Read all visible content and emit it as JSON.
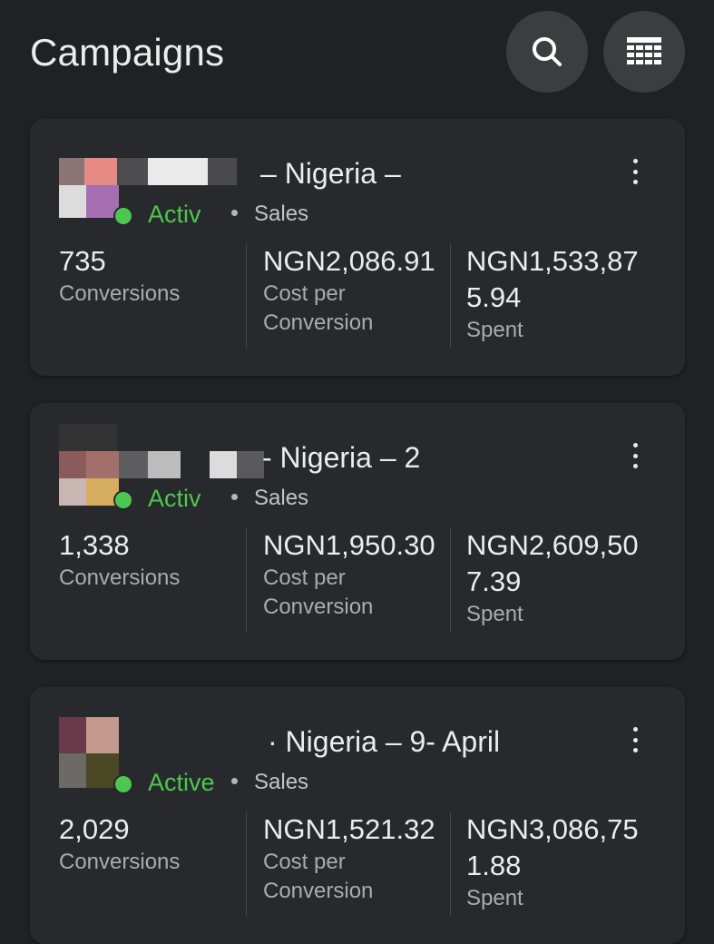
{
  "header": {
    "title": "Campaigns",
    "search_icon": "search-icon",
    "table_icon": "table-view-icon"
  },
  "colors": {
    "background": "#202124",
    "card": "#28292c",
    "active_green": "#4cc74f"
  },
  "campaigns": [
    {
      "name": "– Nigeria –",
      "status": "Activ",
      "objective": "Sales",
      "conversions_value": "735",
      "conversions_label": "Conversions",
      "cost_value": "NGN2,086.91",
      "cost_label": "Cost per Conversion",
      "spent_value": "NGN1,533,875.94",
      "spent_label": "Spent"
    },
    {
      "name": "- Nigeria – 2",
      "status": "Activ",
      "objective": "Sales",
      "conversions_value": "1,338",
      "conversions_label": "Conversions",
      "cost_value": "NGN1,950.30",
      "cost_label": "Cost per Conversion",
      "spent_value": "NGN2,609,507.39",
      "spent_label": "Spent"
    },
    {
      "name": "· Nigeria – 9- April",
      "status": "Active",
      "objective": "Sales",
      "conversions_value": "2,029",
      "conversions_label": "Conversions",
      "cost_value": "NGN1,521.32",
      "cost_label": "Cost per Conversion",
      "spent_value": "NGN3,086,751.88",
      "spent_label": "Spent"
    }
  ]
}
